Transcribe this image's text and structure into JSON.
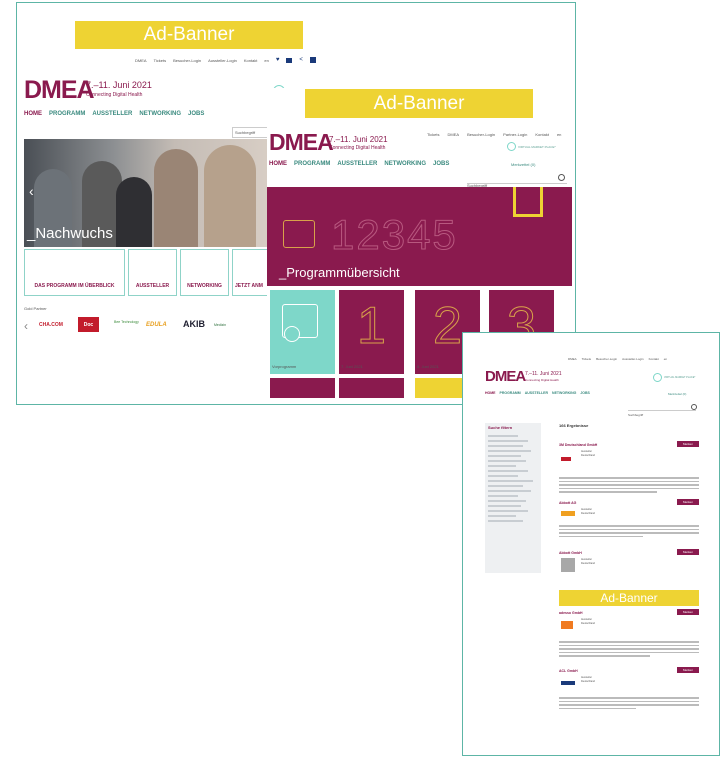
{
  "shot1": {
    "ad_banner": "Ad-Banner",
    "topbar": [
      "DMEA",
      "Tickets",
      "Besucher-Login",
      "Aussteller-Login",
      "Kontakt",
      "en"
    ],
    "logo": "DMEA",
    "date": "7.–11. Juni 2021",
    "tagline": "Connecting Digital Health",
    "virtual_label": "VIRTUAL MARKET PLACE*",
    "nav": [
      "HOME",
      "PROGRAMM",
      "AUSSTELLER",
      "NETWORKING",
      "JOBS"
    ],
    "search_placeholder": "Suchbegriff",
    "hero_caption": "_Nachwuchs",
    "tiles": [
      "DAS PROGRAMM IM ÜBERBLICK",
      "AUSSTELLER",
      "NETWORKING",
      "JETZT ANM"
    ],
    "partners_heading": "Gold Partner",
    "partners": [
      "CHA.COM",
      "Doc",
      "Bee Technology",
      "EDULA",
      "AKIB",
      "Medizin"
    ]
  },
  "shot2": {
    "ad_banner": "Ad-Banner",
    "topbar": [
      "Tickets",
      "DMEA",
      "Besucher-Login",
      "Partner-Login",
      "Kontakt",
      "en"
    ],
    "logo": "DMEA",
    "date": "7.–11. Juni 2021",
    "tagline": "Connecting Digital Health",
    "virtual_label": "VIRTUAL MARKET PLACE*",
    "nav": [
      "HOME",
      "PROGRAMM",
      "AUSSTELLER",
      "NETWORKING",
      "JOBS"
    ],
    "merkzettel": "Merkzettel (0)",
    "search_placeholder": "Suchbegriff",
    "hero_numbers": "12345",
    "hero_caption": "_Programmübersicht",
    "day_tiles": [
      {
        "label": "Vorprogramm",
        "glyph": ""
      },
      {
        "label": "7. Juni 2021",
        "glyph": "1"
      },
      {
        "label": "8. Juni 2021",
        "glyph": "2"
      },
      {
        "label": "",
        "glyph": "3"
      }
    ]
  },
  "shot3": {
    "ad_banner": "Ad-Banner",
    "topbar": [
      "DMEA",
      "Tickets",
      "Besucher-Login",
      "Aussteller-Login",
      "Kontakt",
      "en"
    ],
    "logo": "DMEA",
    "date": "7.–11. Juni 2021",
    "tagline": "Connecting Digital Health",
    "virtual_label": "VIRTUAL MARKET PLACE*",
    "nav": [
      "HOME",
      "PROGRAMM",
      "AUSSTELLER",
      "NETWORKING",
      "JOBS"
    ],
    "merkzettel": "Merkzettel (0)",
    "search_placeholder": "Suchbegriff",
    "sidebar_title": "Suche filtern",
    "results_title": "166 Ergebnisse",
    "merken_label": "Merken",
    "results": [
      {
        "name": "3M Deutschland GmbH",
        "city": "Aussteller",
        "country": "Deutschland"
      },
      {
        "name": "Abbott AG",
        "city": "Aussteller",
        "country": "Deutschland"
      },
      {
        "name": "Abbott GmbH",
        "city": "Aussteller",
        "country": "Deutschland"
      },
      {
        "name": "adesso GmbH",
        "city": "Aussteller",
        "country": "Deutschland"
      },
      {
        "name": "ACL GmbH",
        "city": "Aussteller",
        "country": "Deutschland"
      }
    ]
  },
  "colors": {
    "accent_plum": "#8a1a4e",
    "accent_mint": "#7ed7c9",
    "banner_yellow": "#eed333",
    "frame_teal": "#5db5a6"
  }
}
